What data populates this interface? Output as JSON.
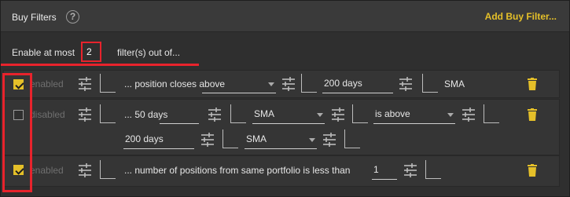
{
  "header": {
    "title": "Buy Filters",
    "help_icon": "?",
    "add_filter_label": "Add Buy Filter..."
  },
  "enable": {
    "prefix": "Enable at most",
    "value": "2",
    "suffix": "filter(s) out of..."
  },
  "filters": [
    {
      "checked": true,
      "status": "enabled",
      "text1": "... position closes above",
      "input1": "200 days",
      "text2": "SMA"
    },
    {
      "checked": false,
      "status": "disabled",
      "text1": "... 50 days",
      "select1": "SMA",
      "select2": "is above",
      "input1": "200 days",
      "select3": "SMA"
    },
    {
      "checked": true,
      "status": "enabled",
      "text1": "... number of positions from same portfolio is less than",
      "input1": "1"
    }
  ],
  "colors": {
    "accent": "#e5c029",
    "highlight": "#e8232c",
    "background": "#2f2f2f"
  }
}
